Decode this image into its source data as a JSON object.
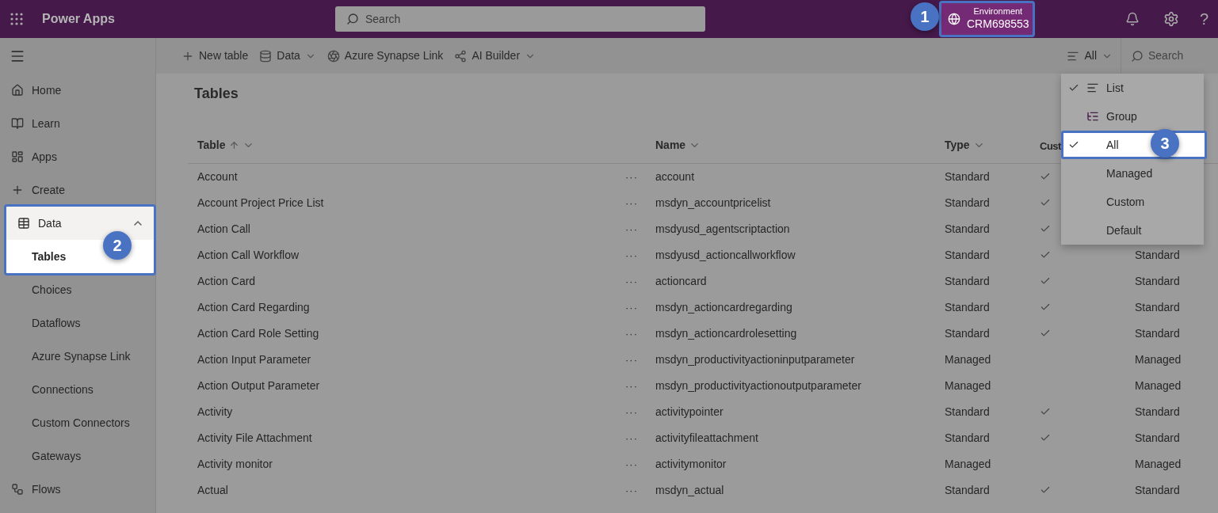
{
  "top_bar": {
    "app_name": "Power Apps",
    "search": {
      "placeholder": "Search"
    },
    "environment": {
      "label": "Environment",
      "name": "CRM698553",
      "highlighted": true
    },
    "callout": "1",
    "help_glyph": "?"
  },
  "sidebar": {
    "callout": "2",
    "items": [
      {
        "label": "Home"
      },
      {
        "label": "Learn"
      },
      {
        "label": "Apps"
      },
      {
        "label": "Create"
      },
      {
        "label": "Data",
        "expanded": true,
        "highlighted": true,
        "children": [
          {
            "label": "Tables",
            "selected": true
          },
          {
            "label": "Choices",
            "selected": false
          },
          {
            "label": "Dataflows",
            "selected": false
          },
          {
            "label": "Azure Synapse Link",
            "selected": false
          },
          {
            "label": "Connections",
            "selected": false
          },
          {
            "label": "Custom Connectors",
            "selected": false
          },
          {
            "label": "Gateways",
            "selected": false
          }
        ]
      },
      {
        "label": "Flows"
      }
    ]
  },
  "toolbar": {
    "items": [
      {
        "label": "New table",
        "has_menu": false
      },
      {
        "label": "Data",
        "has_menu": true
      },
      {
        "label": "Azure Synapse Link",
        "has_menu": false
      },
      {
        "label": "AI Builder",
        "has_menu": true
      }
    ],
    "view_filter": "All",
    "search": {
      "placeholder": "Search"
    }
  },
  "page_title": "Tables",
  "table": {
    "columns": [
      {
        "label": "Table",
        "sorted": true
      },
      {
        "label": "Name"
      },
      {
        "label": "Type"
      },
      {
        "label": "Cust"
      }
    ],
    "more_glyph": "···",
    "rows": [
      {
        "table": "Account",
        "name": "account",
        "type": "Standard",
        "custom": true
      },
      {
        "table": "Account Project Price List",
        "name": "msdyn_accountpricelist",
        "type": "Standard",
        "custom": true
      },
      {
        "table": "Action Call",
        "name": "msdyusd_agentscriptaction",
        "type": "Standard",
        "custom": true
      },
      {
        "table": "Action Call Workflow",
        "name": "msdyusd_actioncallworkflow",
        "type": "Standard",
        "custom": true,
        "column_5": "Standard"
      },
      {
        "table": "Action Card",
        "name": "actioncard",
        "type": "Standard",
        "custom": true,
        "column_5": "Standard"
      },
      {
        "table": "Action Card Regarding",
        "name": "msdyn_actioncardregarding",
        "type": "Standard",
        "custom": true,
        "column_5": "Standard"
      },
      {
        "table": "Action Card Role Setting",
        "name": "msdyn_actioncardrolesetting",
        "type": "Standard",
        "custom": true,
        "column_5": "Standard"
      },
      {
        "table": "Action Input Parameter",
        "name": "msdyn_productivityactioninputparameter",
        "type": "Managed",
        "custom": false,
        "column_5": "Managed"
      },
      {
        "table": "Action Output Parameter",
        "name": "msdyn_productivityactionoutputparameter",
        "type": "Managed",
        "custom": false,
        "column_5": "Managed"
      },
      {
        "table": "Activity",
        "name": "activitypointer",
        "type": "Standard",
        "custom": true,
        "column_5": "Standard"
      },
      {
        "table": "Activity File Attachment",
        "name": "activityfileattachment",
        "type": "Standard",
        "custom": true,
        "column_5": "Standard"
      },
      {
        "table": "Activity monitor",
        "name": "activitymonitor",
        "type": "Managed",
        "custom": false,
        "column_5": "Managed"
      },
      {
        "table": "Actual",
        "name": "msdyn_actual",
        "type": "Standard",
        "custom": true,
        "column_5": "Standard"
      }
    ]
  },
  "menu": {
    "callout": "3",
    "items": [
      {
        "label": "List",
        "kind": "view",
        "checked": true,
        "highlighted": false
      },
      {
        "label": "Group",
        "kind": "view",
        "checked": false,
        "highlighted": false
      },
      {
        "label": "All",
        "kind": "filter",
        "checked": true,
        "highlighted": true
      },
      {
        "label": "Managed",
        "kind": "filter",
        "checked": false,
        "highlighted": false
      },
      {
        "label": "Custom",
        "kind": "filter",
        "checked": false,
        "highlighted": false
      },
      {
        "label": "Default",
        "kind": "filter",
        "checked": false,
        "highlighted": false
      }
    ]
  }
}
